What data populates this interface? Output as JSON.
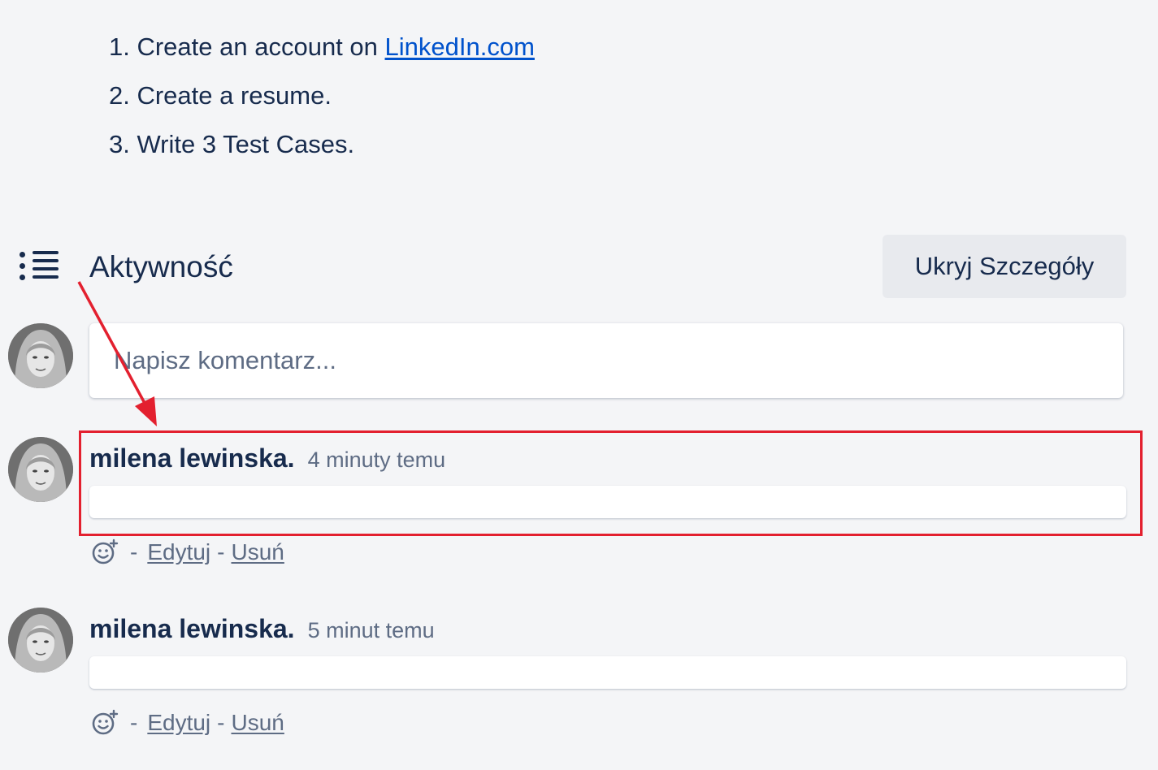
{
  "description": {
    "items": [
      {
        "prefix": "1. Create an account on ",
        "link": "LinkedIn.com"
      },
      {
        "prefix": "2. Create a resume.",
        "link": ""
      },
      {
        "prefix": "3. Write 3 Test Cases.",
        "link": ""
      }
    ]
  },
  "activity": {
    "title": "Aktywność",
    "icon": "activity-list-icon",
    "hide_details_label": "Ukryj Szczegóły"
  },
  "new_comment": {
    "placeholder": "Napisz komentarz..."
  },
  "comments": [
    {
      "author": "milena lewinska.",
      "time": "4 minuty temu",
      "body": "",
      "dash": "-",
      "edit_label": "Edytuj",
      "delete_label": "Usuń"
    },
    {
      "author": "milena lewinska.",
      "time": "5 minut temu",
      "body": "",
      "dash": "-",
      "edit_label": "Edytuj",
      "delete_label": "Usuń"
    }
  ],
  "annotation": {
    "color": "#e3202f"
  },
  "colors": {
    "background": "#f4f5f7",
    "text": "#172b4d",
    "link": "#0052cc",
    "muted": "#5e6c84"
  }
}
